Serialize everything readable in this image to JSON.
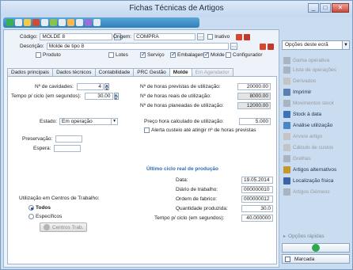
{
  "window": {
    "title": "Fichas Técnicas de Artigos"
  },
  "header": {
    "codigo_label": "Código:",
    "codigo_value": "MOLDE 8",
    "origem_label": "Origem:",
    "origem_value": "COMPRA",
    "inativo_label": "Inativo",
    "descricao_label": "Descrição:",
    "descricao_value": "Molde de tipo 8",
    "checks": [
      {
        "label": "Produto",
        "checked": false
      },
      {
        "label": "Lotes",
        "checked": false
      },
      {
        "label": "Serviço",
        "checked": true
      },
      {
        "label": "Embalagem",
        "checked": true
      },
      {
        "label": "Molde",
        "checked": true
      },
      {
        "label": "Configurador",
        "checked": false
      }
    ]
  },
  "tabs": [
    {
      "label": "Dados principais",
      "state": "normal"
    },
    {
      "label": "Dados técnicos",
      "state": "normal"
    },
    {
      "label": "Contabilidade",
      "state": "normal"
    },
    {
      "label": "PRC Gestão",
      "state": "normal"
    },
    {
      "label": "Molde",
      "state": "active"
    },
    {
      "label": "Em Agendador",
      "state": "disabled"
    }
  ],
  "molde": {
    "cavidades_label": "Nº de cavidades:",
    "cavidades_value": "4",
    "tempo_ciclo_label": "Tempo p/ ciclo (em segundos):",
    "tempo_ciclo_value": "30.00",
    "horas_previstas_label": "Nº de horas previstas de utilização:",
    "horas_previstas_value": "20000.00",
    "horas_reais_label": "Nº de horas reais de utilização:",
    "horas_reais_value": "8000.00",
    "horas_planeadas_label": "Nº de horas planeadas de utilização:",
    "horas_planeadas_value": "12000.00",
    "estado_label": "Estado:",
    "estado_value": "Em operação",
    "preco_hora_label": "Preço hora calculado de utilização:",
    "preco_hora_value": "5.000",
    "alerta_label": "Alerta custeio até atingir nº de horas previstas",
    "preservacao_label": "Preservação:",
    "espera_label": "Espera:",
    "ultimo_ciclo_title": "Último ciclo real de produção",
    "data_label": "Data:",
    "data_value": "19.05.2014",
    "diario_label": "Diário de trabalho:",
    "diario_value": "000000010",
    "ordem_label": "Ordem de fabrico:",
    "ordem_value": "000000012",
    "quantidade_label": "Quantidade produzida:",
    "quantidade_value": "30.0",
    "tempo_ciclo_real_label": "Tempo p/ ciclo (em segundos):",
    "tempo_ciclo_real_value": "40.000000",
    "utilizacao_label": "Utilização em Centros de Trabalho:",
    "radio_todos": "Todos",
    "radio_especificos": "Específicos",
    "centros_btn": "Centros Trab."
  },
  "sidebar": {
    "options_label": "Opções deste ecrã",
    "items": [
      {
        "label": "Gama operativa",
        "state": "disabled",
        "color": "#9fa9b5"
      },
      {
        "label": "Lista de operações",
        "state": "disabled",
        "color": "#9fa9b5"
      },
      {
        "label": "Derivados",
        "state": "disabled",
        "color": "#b7b7b7"
      },
      {
        "label": "Imprimir",
        "state": "enabled",
        "color": "#5b7fae"
      },
      {
        "label": "Movimentos stock",
        "state": "disabled",
        "color": "#9fa9b5"
      },
      {
        "label": "Stock à data",
        "state": "enabled",
        "color": "#3d72b8"
      },
      {
        "label": "Análise utilização",
        "state": "enabled",
        "color": "#4a86c8"
      },
      {
        "label": "Arvore artigo",
        "state": "disabled",
        "color": "#b7b7b7"
      },
      {
        "label": "Cálculo de custos",
        "state": "disabled",
        "color": "#b7b7b7"
      },
      {
        "label": "Grelhas",
        "state": "disabled",
        "color": "#9fa9b5"
      },
      {
        "label": "Artigos alternativos",
        "state": "enabled",
        "color": "#c7972a"
      },
      {
        "label": "Localização física",
        "state": "enabled",
        "color": "#3b64a8"
      },
      {
        "label": "Artigos Gémeos",
        "state": "disabled",
        "color": "#9fa9b5"
      }
    ],
    "quick_options": "Opções rápidas",
    "marcada": "Marcada"
  }
}
